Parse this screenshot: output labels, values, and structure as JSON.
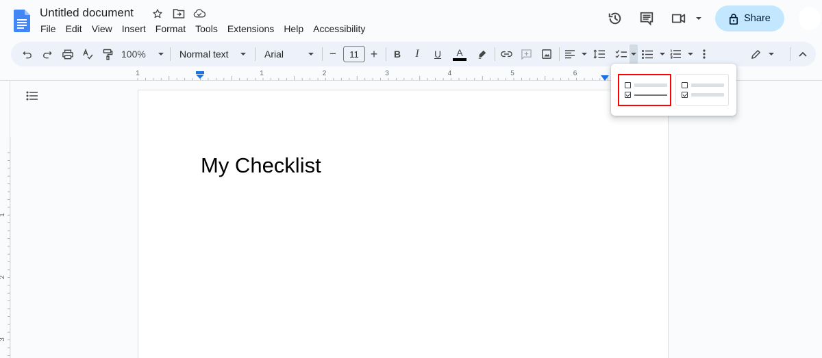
{
  "header": {
    "title": "Untitled document",
    "title_icons": [
      "star-icon",
      "move-to-folder-icon",
      "cloud-saved-icon"
    ],
    "menu": [
      "File",
      "Edit",
      "View",
      "Insert",
      "Format",
      "Tools",
      "Extensions",
      "Help",
      "Accessibility"
    ],
    "right_icons": [
      "version-history-icon",
      "comments-icon",
      "meet-icon"
    ],
    "share_label": "Share"
  },
  "toolbar": {
    "zoom": "100%",
    "style": "Normal text",
    "font": "Arial",
    "font_size": "11",
    "minus": "−",
    "plus": "+",
    "bold": "B",
    "italic": "I",
    "underline": "U",
    "text_color_glyph": "A",
    "text_color": "#000000"
  },
  "ruler": {
    "labels": [
      "1",
      "1",
      "2",
      "3",
      "4",
      "5",
      "6"
    ]
  },
  "vruler": {
    "labels": [
      "1",
      "2",
      "3"
    ]
  },
  "document": {
    "heading": "My Checklist"
  },
  "checklist_menu": {
    "options": [
      {
        "name": "checklist-strikethrough",
        "selected": true
      },
      {
        "name": "checklist-no-strikethrough",
        "selected": false
      }
    ],
    "highlight_color": "#ff0000"
  },
  "colors": {
    "accent": "#1a73e8",
    "share_bg": "#c2e7ff",
    "toolbar_bg": "#edf2fa"
  }
}
